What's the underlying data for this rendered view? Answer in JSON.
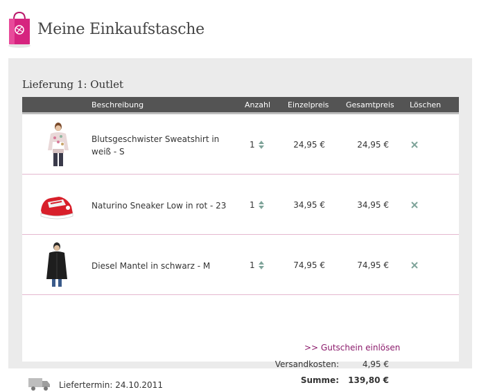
{
  "header": {
    "title": "Meine Einkaufstasche",
    "logo_icon": "shopping-bag-icon"
  },
  "delivery": {
    "title": "Lieferung 1: Outlet"
  },
  "table": {
    "columns": {
      "description": "Beschreibung",
      "quantity": "Anzahl",
      "unit_price": "Einzelpreis",
      "total_price": "Gesamtpreis",
      "delete": "Löschen"
    },
    "rows": [
      {
        "description": "Blutsgeschwister Sweatshirt in weiß - S",
        "quantity": "1",
        "unit_price": "24,95 €",
        "total_price": "24,95 €"
      },
      {
        "description": "Naturino Sneaker Low in rot - 23",
        "quantity": "1",
        "unit_price": "34,95 €",
        "total_price": "34,95 €"
      },
      {
        "description": "Diesel Mantel in schwarz - M",
        "quantity": "1",
        "unit_price": "74,95 €",
        "total_price": "74,95 €"
      }
    ]
  },
  "voucher": {
    "label": ">> Gutschein einlösen"
  },
  "summary": {
    "shipping_label": "Versandkosten:",
    "shipping_value": "4,95 €",
    "total_label": "Summe:",
    "total_value": "139,80 €"
  },
  "delivery_date": {
    "text": "Liefertermin: 24.10.2011",
    "icon": "truck-icon"
  },
  "colors": {
    "accent": "#d6247f",
    "link": "#8b1a6b",
    "header_bar": "#545454",
    "panel": "#ebebeb",
    "row_divider": "#e4b7cf",
    "delete_icon": "#7fa49a"
  }
}
